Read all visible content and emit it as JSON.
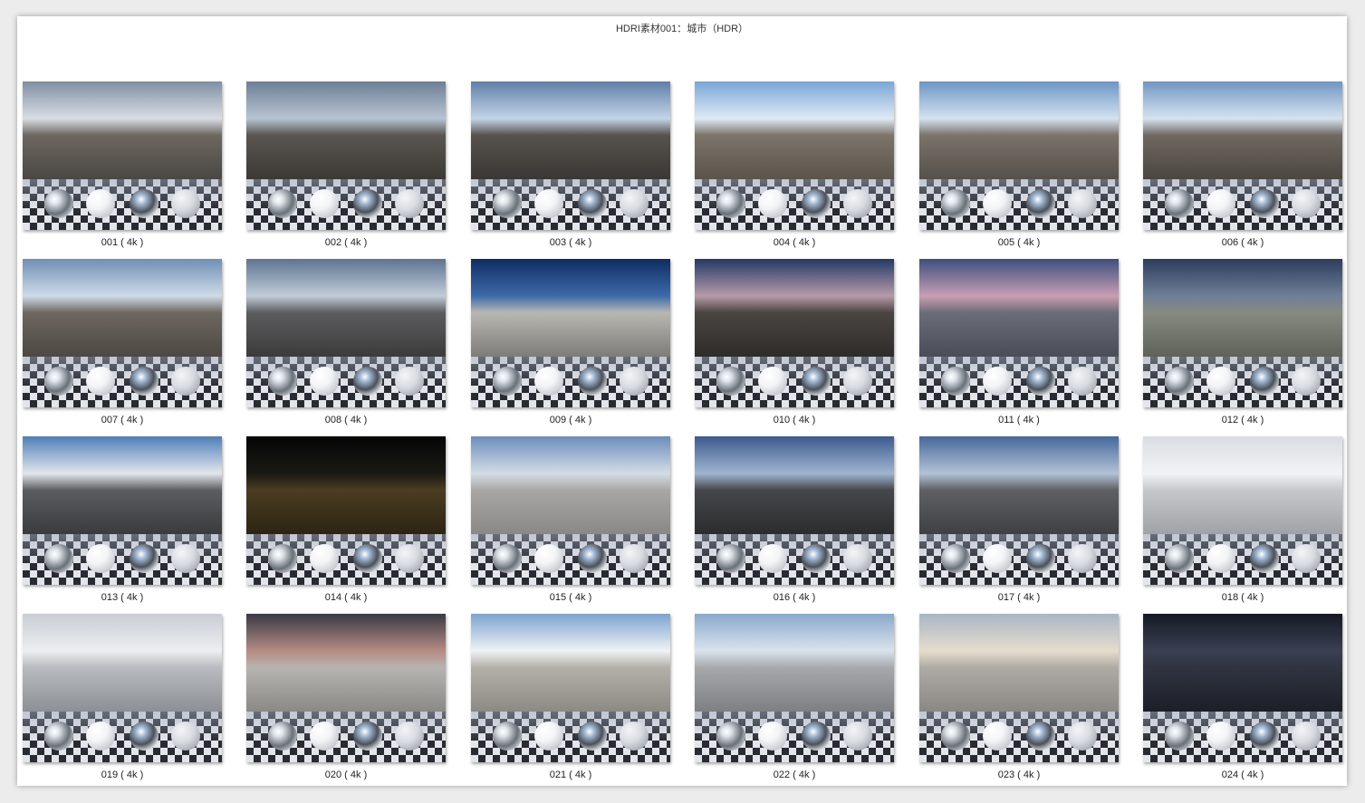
{
  "page": {
    "title": "HDRI素材001：城市（HDR）"
  },
  "items": [
    {
      "label": "001 ( 4k )",
      "sky": [
        "#7f8fa3",
        "#d9dde4"
      ],
      "ground": [
        "#4a4744",
        "#6d6760"
      ]
    },
    {
      "label": "002 ( 4k )",
      "sky": [
        "#6e7f94",
        "#b7c4d2"
      ],
      "ground": [
        "#3c3935",
        "#5a5550"
      ]
    },
    {
      "label": "003 ( 4k )",
      "sky": [
        "#5f7fa8",
        "#c3d4e6"
      ],
      "ground": [
        "#3a3734",
        "#57524d"
      ]
    },
    {
      "label": "004 ( 4k )",
      "sky": [
        "#7aa6d6",
        "#dfeaf4"
      ],
      "ground": [
        "#5b544c",
        "#7d746a"
      ]
    },
    {
      "label": "005 ( 4k )",
      "sky": [
        "#6d95c4",
        "#d4e2ef"
      ],
      "ground": [
        "#55504a",
        "#7b736a"
      ]
    },
    {
      "label": "006 ( 4k )",
      "sky": [
        "#7096c2",
        "#d6e3ef"
      ],
      "ground": [
        "#4b4641",
        "#6f6860"
      ]
    },
    {
      "label": "007 ( 4k )",
      "sky": [
        "#6f8fb5",
        "#cfdbe7"
      ],
      "ground": [
        "#4d4843",
        "#6e6760"
      ]
    },
    {
      "label": "008 ( 4k )",
      "sky": [
        "#5e7491",
        "#c1ccd8"
      ],
      "ground": [
        "#3b3b3c",
        "#5c5c5e"
      ]
    },
    {
      "label": "009 ( 4k )",
      "sky": [
        "#0e2d63",
        "#3d6aa8"
      ],
      "ground": [
        "#7e7c78",
        "#b9b7b2"
      ]
    },
    {
      "label": "010 ( 4k )",
      "sky": [
        "#233a66",
        "#b79aa8"
      ],
      "ground": [
        "#2e2c2a",
        "#4a4541"
      ]
    },
    {
      "label": "011 ( 4k )",
      "sky": [
        "#3c4f7d",
        "#c99eb3"
      ],
      "ground": [
        "#4a4d58",
        "#6a6d78"
      ]
    },
    {
      "label": "012 ( 4k )",
      "sky": [
        "#2c3d5e",
        "#6f7f96"
      ],
      "ground": [
        "#5f6258",
        "#878a80"
      ]
    },
    {
      "label": "013 ( 4k )",
      "sky": [
        "#4f7fb8",
        "#e2e6ea"
      ],
      "ground": [
        "#3a3b3d",
        "#5c5d60"
      ]
    },
    {
      "label": "014 ( 4k )",
      "sky": [
        "#050505",
        "#1a1a14"
      ],
      "ground": [
        "#2d2414",
        "#4b3d22"
      ]
    },
    {
      "label": "015 ( 4k )",
      "sky": [
        "#6c8dba",
        "#d3dce6"
      ],
      "ground": [
        "#8a8886",
        "#a9a7a4"
      ]
    },
    {
      "label": "016 ( 4k )",
      "sky": [
        "#3d5a8f",
        "#9fb5cf"
      ],
      "ground": [
        "#2b2c2e",
        "#46474a"
      ]
    },
    {
      "label": "017 ( 4k )",
      "sky": [
        "#46689b",
        "#b3c2d6"
      ],
      "ground": [
        "#3f4043",
        "#5f6064"
      ]
    },
    {
      "label": "018 ( 4k )",
      "sky": [
        "#d9dde2",
        "#f2f3f5"
      ],
      "ground": [
        "#9fa2a6",
        "#c6c8cb"
      ]
    },
    {
      "label": "019 ( 4k )",
      "sky": [
        "#c9ced5",
        "#eceef0"
      ],
      "ground": [
        "#8c9095",
        "#b8bbbf"
      ]
    },
    {
      "label": "020 ( 4k )",
      "sky": [
        "#3a3a44",
        "#b58c84"
      ],
      "ground": [
        "#8b8986",
        "#b6b4b0"
      ]
    },
    {
      "label": "021 ( 4k )",
      "sky": [
        "#7da3cf",
        "#eef2f5"
      ],
      "ground": [
        "#8c8a84",
        "#b3b0a8"
      ]
    },
    {
      "label": "022 ( 4k )",
      "sky": [
        "#8aa9cc",
        "#d9e3ec"
      ],
      "ground": [
        "#7e7f83",
        "#a7a8ac"
      ]
    },
    {
      "label": "023 ( 4k )",
      "sky": [
        "#a9b6c6",
        "#e6dccb"
      ],
      "ground": [
        "#8a8884",
        "#aeaba5"
      ]
    },
    {
      "label": "024 ( 4k )",
      "sky": [
        "#161a26",
        "#3a3f52"
      ],
      "ground": [
        "#1c1f28",
        "#303441"
      ]
    }
  ]
}
